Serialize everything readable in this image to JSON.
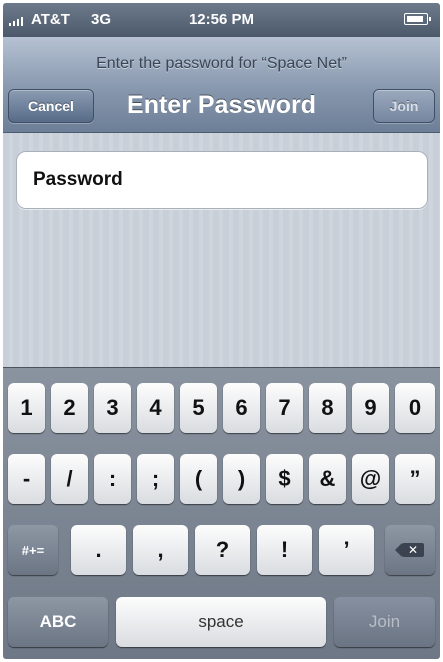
{
  "status_bar": {
    "carrier": "AT&T",
    "network": "3G",
    "time": "12:56 PM"
  },
  "nav": {
    "prompt": "Enter the password for “Space Net”",
    "title": "Enter Password",
    "cancel_label": "Cancel",
    "join_label": "Join"
  },
  "form": {
    "password_label": "Password",
    "password_value": ""
  },
  "keyboard": {
    "row1": [
      "1",
      "2",
      "3",
      "4",
      "5",
      "6",
      "7",
      "8",
      "9",
      "0"
    ],
    "row2": [
      "-",
      "/",
      ":",
      ";",
      "(",
      ")",
      "$",
      "&",
      "@",
      "”"
    ],
    "row3_left": "#+=",
    "row3": [
      ".",
      ",",
      "?",
      "!",
      "’"
    ],
    "abc_label": "ABC",
    "space_label": "space",
    "join_label": "Join"
  },
  "colors": {
    "nav_gradient_top": "#b6c2d3",
    "nav_gradient_bottom": "#6d7f98",
    "keyboard_bg": "#7b8491",
    "key_face": "#f4f5f6"
  }
}
